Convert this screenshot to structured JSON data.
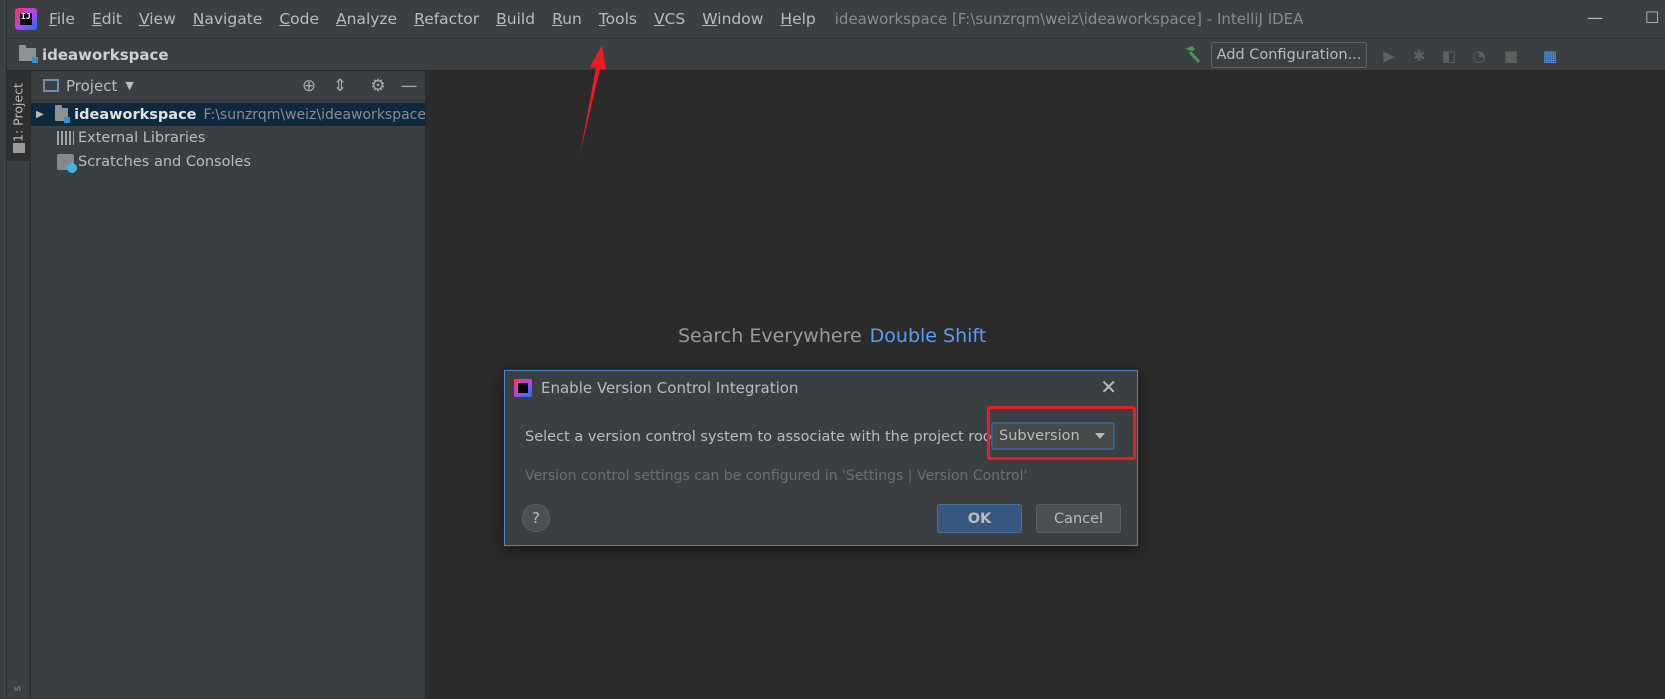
{
  "app": {
    "icon": "intellij-idea-icon",
    "icon_text": "IJ",
    "window_title": "ideaworkspace [F:\\sunzrqm\\weiz\\ideaworkspace] - IntelliJ IDEA",
    "minimize_glyph": "—",
    "maximize_glyph": "☐"
  },
  "menu": [
    {
      "name": "menu-file",
      "label": "File"
    },
    {
      "name": "menu-edit",
      "label": "Edit"
    },
    {
      "name": "menu-view",
      "label": "View"
    },
    {
      "name": "menu-navigate",
      "label": "Navigate"
    },
    {
      "name": "menu-code",
      "label": "Code"
    },
    {
      "name": "menu-analyze",
      "label": "Analyze"
    },
    {
      "name": "menu-refactor",
      "label": "Refactor"
    },
    {
      "name": "menu-build",
      "label": "Build"
    },
    {
      "name": "menu-run",
      "label": "Run"
    },
    {
      "name": "menu-tools",
      "label": "Tools"
    },
    {
      "name": "menu-vcs",
      "label": "VCS"
    },
    {
      "name": "menu-window",
      "label": "Window"
    },
    {
      "name": "menu-help",
      "label": "Help"
    }
  ],
  "navbar": {
    "project_name": "ideaworkspace",
    "add_configuration": "Add Configuration...",
    "toolbar_glyphs": {
      "run": "▶",
      "debug": "✱",
      "coverage": "◧",
      "profile": "◔",
      "stop": "■",
      "structure": "▦"
    }
  },
  "tool_strip": {
    "project_tab": "1: Project",
    "bottom_tab": "s"
  },
  "project_panel": {
    "title": "Project",
    "caret": "▼",
    "header_glyphs": {
      "locate": "⊕",
      "collapse": "⇕",
      "settings": "⚙",
      "hide": "—"
    },
    "tree": [
      {
        "label": "ideaworkspace",
        "path": "F:\\sunzrqm\\weiz\\ideaworkspace",
        "expander": "▶"
      },
      {
        "label": "External Libraries"
      },
      {
        "label": "Scratches and Consoles"
      }
    ]
  },
  "editor": {
    "hint_text": "Search Everywhere",
    "hint_shortcut": "Double Shift"
  },
  "dialog": {
    "title": "Enable Version Control Integration",
    "close_glyph": "✕",
    "prompt": "Select a version control system to associate with the project root:",
    "selected_vcs": "Subversion",
    "note": "Version control settings can be configured in 'Settings | Version Control'",
    "help_glyph": "?",
    "ok": "OK",
    "cancel": "Cancel",
    "highlight_color": "#ec1c24"
  },
  "colors": {
    "background": "#2b2b2b",
    "panel": "#3c3f41",
    "selection": "#0d293e",
    "link_blue": "#589df6",
    "primary_button": "#365880",
    "annotation_red": "#ec1c24"
  }
}
